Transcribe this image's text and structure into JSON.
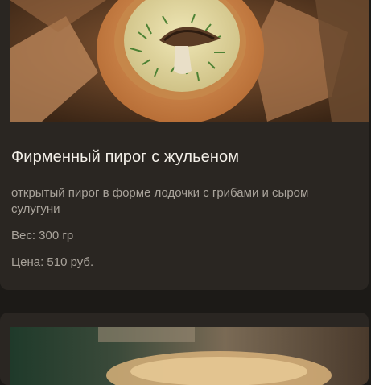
{
  "cards": [
    {
      "image": "pie-photo",
      "title": "Фирменный пирог с жульеном",
      "description": "открытый пирог в форме лодочки с грибами и сыром сулугуни",
      "weight": "Вес: 300 гр",
      "price": "Цена: 510 руб."
    },
    {
      "image": "pie-photo-2"
    }
  ],
  "colors": {
    "background": "#1c1a17",
    "card": "#2a2622",
    "title": "#f3efe8",
    "text": "#a9a39b"
  }
}
